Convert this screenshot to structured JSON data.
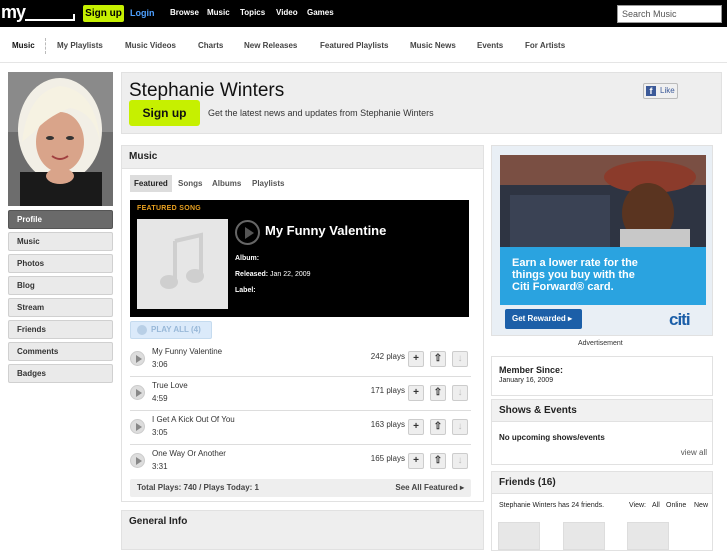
{
  "topbar": {
    "logo": "my",
    "signup": "Sign up",
    "login": "Login",
    "nav": [
      "Browse",
      "Music",
      "Topics",
      "Video",
      "Games"
    ],
    "search_placeholder": "Search Music"
  },
  "subnav": [
    "Music",
    "My Playlists",
    "Music Videos",
    "Charts",
    "New Releases",
    "Featured Playlists",
    "Music News",
    "Events",
    "For Artists"
  ],
  "sidebar": {
    "items": [
      "Profile",
      "Music",
      "Photos",
      "Blog",
      "Stream",
      "Friends",
      "Comments",
      "Badges"
    ]
  },
  "header": {
    "name": "Stephanie Winters",
    "signup": "Sign up",
    "tagline": "Get the latest news and updates from Stephanie Winters",
    "like": "Like"
  },
  "music": {
    "title": "Music",
    "tabs": [
      "Featured",
      "Songs",
      "Albums",
      "Playlists"
    ],
    "featured": {
      "label": "FEATURED SONG",
      "title": "My Funny Valentine",
      "album_label": "Album:",
      "album": "",
      "released_label": "Released:",
      "released": "Jan 22, 2009",
      "label_label": "Label:",
      "label_value": ""
    },
    "play_all": "PLAY ALL (4)",
    "songs": [
      {
        "title": "My Funny Valentine",
        "duration": "3:06",
        "plays": "242 plays"
      },
      {
        "title": "True Love",
        "duration": "4:59",
        "plays": "171 plays"
      },
      {
        "title": "I Get A Kick Out Of You",
        "duration": "3:05",
        "plays": "163 plays"
      },
      {
        "title": "One Way Or Another",
        "duration": "3:31",
        "plays": "165 plays"
      }
    ],
    "totals": "Total Plays: 740 / Plays Today: 1",
    "see_all": "See All Featured ▸"
  },
  "general_info": "General Info",
  "ad": {
    "headline_1": "Earn a lower rate for the",
    "headline_2": "things you buy with the",
    "headline_3": "Citi Forward® card.",
    "button": "Get Rewarded ▸",
    "brand": "citi",
    "label": "Advertisement"
  },
  "member": {
    "label": "Member Since:",
    "date": "January 16, 2009"
  },
  "shows": {
    "title": "Shows & Events",
    "empty": "No upcoming shows/events",
    "view_all": "view all"
  },
  "friends": {
    "title": "Friends (16)",
    "summary": "Stephanie Winters has 24 friends.",
    "view_label": "View:",
    "filters": [
      "All",
      "Online",
      "New"
    ]
  },
  "colors": {
    "accent": "#c6f000",
    "link": "#4ea0ff",
    "featured_label": "#e8a020",
    "ad_blue": "#2aa3e0",
    "citi_blue": "#1c5fa8"
  }
}
